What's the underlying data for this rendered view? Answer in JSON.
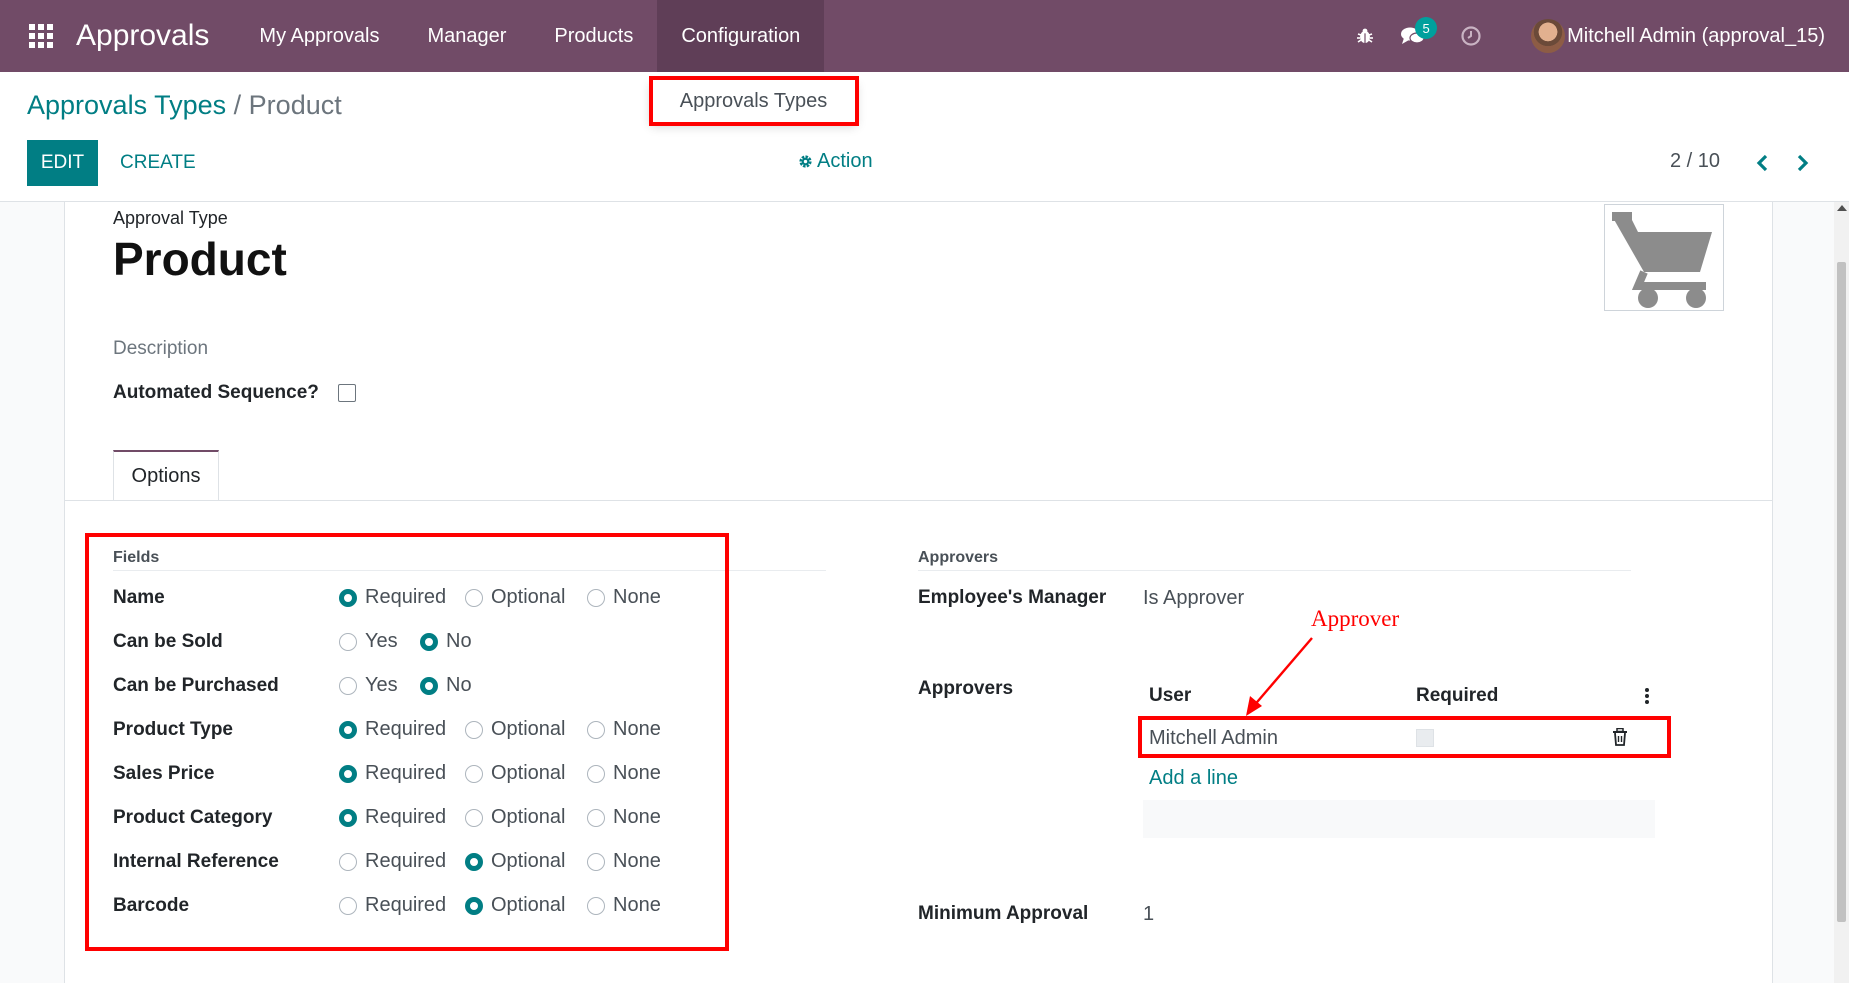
{
  "navbar": {
    "brand": "Approvals",
    "menu": [
      "My Approvals",
      "Manager",
      "Products",
      "Configuration"
    ],
    "active_menu": "Configuration",
    "messages_count": "5",
    "user": "Mitchell Admin (approval_15)",
    "icons": [
      "apps-grid-icon",
      "bug-icon",
      "chat-icon",
      "clock-icon"
    ]
  },
  "dropdown": {
    "item": "Approvals Types"
  },
  "breadcrumb": {
    "parent": "Approvals Types",
    "separator": "/",
    "current": "Product"
  },
  "buttons": {
    "edit": "EDIT",
    "create": "CREATE",
    "action": "Action"
  },
  "pager": {
    "value": "2 / 10"
  },
  "form": {
    "type_label": "Approval Type",
    "name": "Product",
    "description_placeholder": "Description",
    "auto_seq_label": "Automated Sequence?",
    "auto_seq_checked": false,
    "tab": "Options"
  },
  "fields_group": {
    "title": "Fields",
    "rows": [
      {
        "label": "Name",
        "options": [
          "Required",
          "Optional",
          "None"
        ],
        "selected": 0
      },
      {
        "label": "Can be Sold",
        "options": [
          "Yes",
          "No"
        ],
        "selected": 1
      },
      {
        "label": "Can be Purchased",
        "options": [
          "Yes",
          "No"
        ],
        "selected": 1
      },
      {
        "label": "Product Type",
        "options": [
          "Required",
          "Optional",
          "None"
        ],
        "selected": 0
      },
      {
        "label": "Sales Price",
        "options": [
          "Required",
          "Optional",
          "None"
        ],
        "selected": 0
      },
      {
        "label": "Product Category",
        "options": [
          "Required",
          "Optional",
          "None"
        ],
        "selected": 0
      },
      {
        "label": "Internal Reference",
        "options": [
          "Required",
          "Optional",
          "None"
        ],
        "selected": 1
      },
      {
        "label": "Barcode",
        "options": [
          "Required",
          "Optional",
          "None"
        ],
        "selected": 1
      }
    ]
  },
  "approvers_group": {
    "title": "Approvers",
    "employee_manager_label": "Employee's Manager",
    "employee_manager_value": "Is Approver",
    "approvers_label": "Approvers",
    "table_headers": [
      "User",
      "Required"
    ],
    "rows": [
      {
        "user": "Mitchell Admin",
        "required": false
      }
    ],
    "add_line": "Add a line",
    "min_approval_label": "Minimum Approval",
    "min_approval_value": "1"
  },
  "annotation": {
    "text": "Approver",
    "color": "#ff0000"
  },
  "colors": {
    "navbar": "#714b67",
    "primary": "#017e84",
    "highlight": "#ff0000"
  }
}
